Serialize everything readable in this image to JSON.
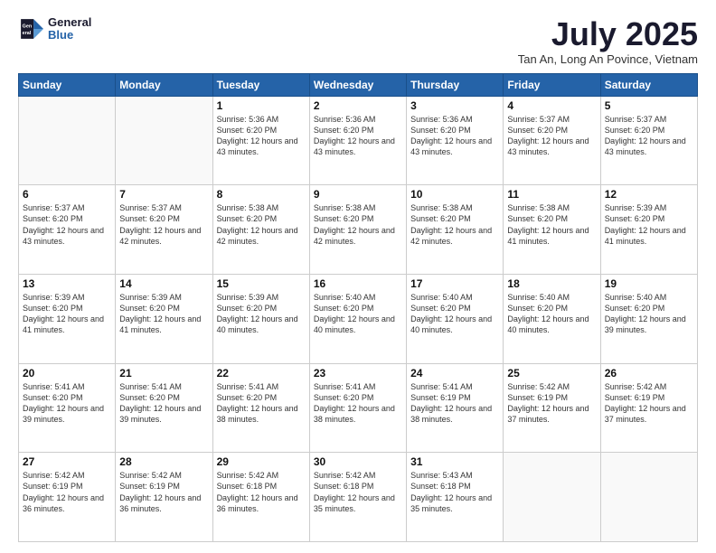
{
  "header": {
    "logo_line1": "General",
    "logo_line2": "Blue",
    "title": "July 2025",
    "subtitle": "Tan An, Long An Povince, Vietnam"
  },
  "calendar": {
    "days_of_week": [
      "Sunday",
      "Monday",
      "Tuesday",
      "Wednesday",
      "Thursday",
      "Friday",
      "Saturday"
    ],
    "weeks": [
      [
        {
          "day": "",
          "info": ""
        },
        {
          "day": "",
          "info": ""
        },
        {
          "day": "1",
          "info": "Sunrise: 5:36 AM\nSunset: 6:20 PM\nDaylight: 12 hours\nand 43 minutes."
        },
        {
          "day": "2",
          "info": "Sunrise: 5:36 AM\nSunset: 6:20 PM\nDaylight: 12 hours\nand 43 minutes."
        },
        {
          "day": "3",
          "info": "Sunrise: 5:36 AM\nSunset: 6:20 PM\nDaylight: 12 hours\nand 43 minutes."
        },
        {
          "day": "4",
          "info": "Sunrise: 5:37 AM\nSunset: 6:20 PM\nDaylight: 12 hours\nand 43 minutes."
        },
        {
          "day": "5",
          "info": "Sunrise: 5:37 AM\nSunset: 6:20 PM\nDaylight: 12 hours\nand 43 minutes."
        }
      ],
      [
        {
          "day": "6",
          "info": "Sunrise: 5:37 AM\nSunset: 6:20 PM\nDaylight: 12 hours\nand 43 minutes."
        },
        {
          "day": "7",
          "info": "Sunrise: 5:37 AM\nSunset: 6:20 PM\nDaylight: 12 hours\nand 42 minutes."
        },
        {
          "day": "8",
          "info": "Sunrise: 5:38 AM\nSunset: 6:20 PM\nDaylight: 12 hours\nand 42 minutes."
        },
        {
          "day": "9",
          "info": "Sunrise: 5:38 AM\nSunset: 6:20 PM\nDaylight: 12 hours\nand 42 minutes."
        },
        {
          "day": "10",
          "info": "Sunrise: 5:38 AM\nSunset: 6:20 PM\nDaylight: 12 hours\nand 42 minutes."
        },
        {
          "day": "11",
          "info": "Sunrise: 5:38 AM\nSunset: 6:20 PM\nDaylight: 12 hours\nand 41 minutes."
        },
        {
          "day": "12",
          "info": "Sunrise: 5:39 AM\nSunset: 6:20 PM\nDaylight: 12 hours\nand 41 minutes."
        }
      ],
      [
        {
          "day": "13",
          "info": "Sunrise: 5:39 AM\nSunset: 6:20 PM\nDaylight: 12 hours\nand 41 minutes."
        },
        {
          "day": "14",
          "info": "Sunrise: 5:39 AM\nSunset: 6:20 PM\nDaylight: 12 hours\nand 41 minutes."
        },
        {
          "day": "15",
          "info": "Sunrise: 5:39 AM\nSunset: 6:20 PM\nDaylight: 12 hours\nand 40 minutes."
        },
        {
          "day": "16",
          "info": "Sunrise: 5:40 AM\nSunset: 6:20 PM\nDaylight: 12 hours\nand 40 minutes."
        },
        {
          "day": "17",
          "info": "Sunrise: 5:40 AM\nSunset: 6:20 PM\nDaylight: 12 hours\nand 40 minutes."
        },
        {
          "day": "18",
          "info": "Sunrise: 5:40 AM\nSunset: 6:20 PM\nDaylight: 12 hours\nand 40 minutes."
        },
        {
          "day": "19",
          "info": "Sunrise: 5:40 AM\nSunset: 6:20 PM\nDaylight: 12 hours\nand 39 minutes."
        }
      ],
      [
        {
          "day": "20",
          "info": "Sunrise: 5:41 AM\nSunset: 6:20 PM\nDaylight: 12 hours\nand 39 minutes."
        },
        {
          "day": "21",
          "info": "Sunrise: 5:41 AM\nSunset: 6:20 PM\nDaylight: 12 hours\nand 39 minutes."
        },
        {
          "day": "22",
          "info": "Sunrise: 5:41 AM\nSunset: 6:20 PM\nDaylight: 12 hours\nand 38 minutes."
        },
        {
          "day": "23",
          "info": "Sunrise: 5:41 AM\nSunset: 6:20 PM\nDaylight: 12 hours\nand 38 minutes."
        },
        {
          "day": "24",
          "info": "Sunrise: 5:41 AM\nSunset: 6:19 PM\nDaylight: 12 hours\nand 38 minutes."
        },
        {
          "day": "25",
          "info": "Sunrise: 5:42 AM\nSunset: 6:19 PM\nDaylight: 12 hours\nand 37 minutes."
        },
        {
          "day": "26",
          "info": "Sunrise: 5:42 AM\nSunset: 6:19 PM\nDaylight: 12 hours\nand 37 minutes."
        }
      ],
      [
        {
          "day": "27",
          "info": "Sunrise: 5:42 AM\nSunset: 6:19 PM\nDaylight: 12 hours\nand 36 minutes."
        },
        {
          "day": "28",
          "info": "Sunrise: 5:42 AM\nSunset: 6:19 PM\nDaylight: 12 hours\nand 36 minutes."
        },
        {
          "day": "29",
          "info": "Sunrise: 5:42 AM\nSunset: 6:18 PM\nDaylight: 12 hours\nand 36 minutes."
        },
        {
          "day": "30",
          "info": "Sunrise: 5:42 AM\nSunset: 6:18 PM\nDaylight: 12 hours\nand 35 minutes."
        },
        {
          "day": "31",
          "info": "Sunrise: 5:43 AM\nSunset: 6:18 PM\nDaylight: 12 hours\nand 35 minutes."
        },
        {
          "day": "",
          "info": ""
        },
        {
          "day": "",
          "info": ""
        }
      ]
    ]
  }
}
